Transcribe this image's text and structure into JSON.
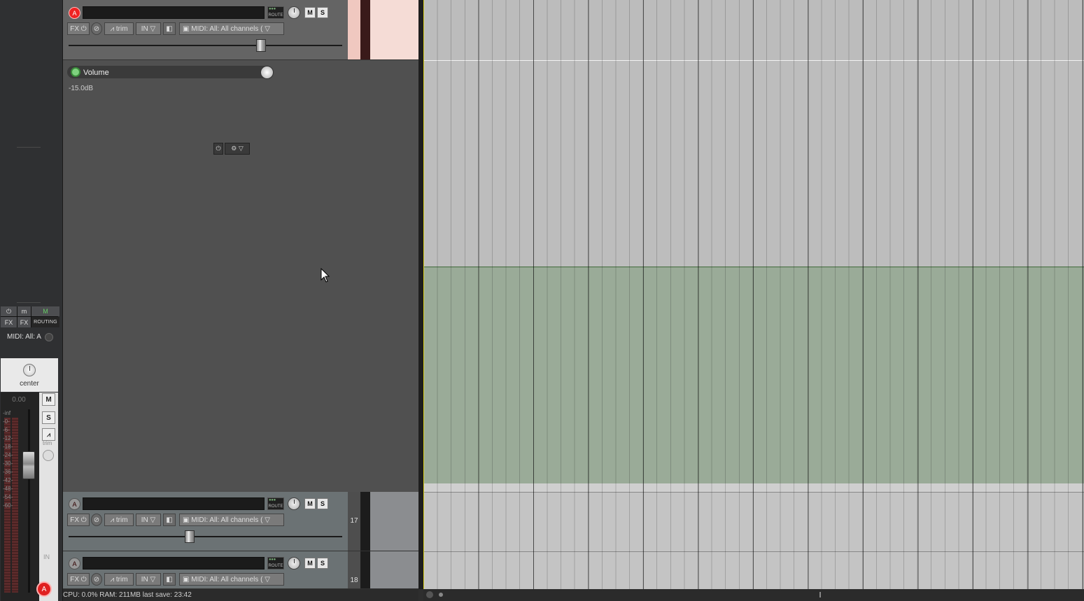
{
  "mixer": {
    "fx_top_left": "FX",
    "fx_top_right": "FX",
    "routing": "ROUTING",
    "midi_label": "MIDI: All: A",
    "pan_label": "center",
    "peak_value": "0.00",
    "meter_scale": [
      "-inf",
      "-0-",
      "-6-",
      "-12-",
      "-18-",
      "-24-",
      "-30-",
      "-36-",
      "-42-",
      "-48-",
      "-54-",
      "-60-"
    ],
    "mute": "M",
    "solo": "S",
    "trim": "trim",
    "in": "IN",
    "arm": "A"
  },
  "tracks": [
    {
      "arm": "A",
      "route": "ROUTE",
      "mute": "M",
      "solo": "S",
      "fx": "FX",
      "trim": "trim",
      "in": "IN",
      "midi": "MIDI: All: All channels (",
      "number": "",
      "fader_level": 0.71,
      "armed": true
    },
    {
      "arm": "A",
      "route": "ROUTE",
      "mute": "M",
      "solo": "S",
      "fx": "FX",
      "trim": "trim",
      "in": "IN",
      "midi": "MIDI: All: All channels (",
      "number": "17",
      "fader_level": 0.44,
      "armed": false
    },
    {
      "arm": "A",
      "route": "ROUTE",
      "mute": "M",
      "solo": "S",
      "fx": "FX",
      "trim": "trim",
      "in": "IN",
      "midi": "MIDI: All: All channels (",
      "number": "18",
      "armed": false
    }
  ],
  "envelope": {
    "name": "Volume",
    "value": "-15.0dB"
  },
  "status": {
    "text": "CPU: 0.0%  RAM: 211MB  last save: 23:42"
  },
  "colors": {
    "envelope_lane": "#9aab98",
    "selected_track_tail": "#f5dcd6",
    "cursor": "#d8d020"
  }
}
